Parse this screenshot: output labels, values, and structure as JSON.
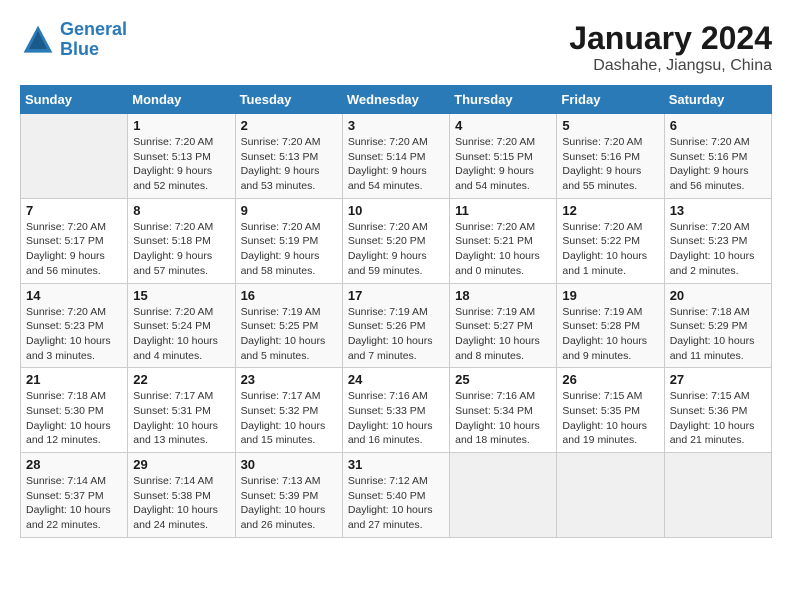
{
  "header": {
    "logo_line1": "General",
    "logo_line2": "Blue",
    "month": "January 2024",
    "location": "Dashahe, Jiangsu, China"
  },
  "weekdays": [
    "Sunday",
    "Monday",
    "Tuesday",
    "Wednesday",
    "Thursday",
    "Friday",
    "Saturday"
  ],
  "weeks": [
    [
      {
        "day": "",
        "info": ""
      },
      {
        "day": "1",
        "info": "Sunrise: 7:20 AM\nSunset: 5:13 PM\nDaylight: 9 hours\nand 52 minutes."
      },
      {
        "day": "2",
        "info": "Sunrise: 7:20 AM\nSunset: 5:13 PM\nDaylight: 9 hours\nand 53 minutes."
      },
      {
        "day": "3",
        "info": "Sunrise: 7:20 AM\nSunset: 5:14 PM\nDaylight: 9 hours\nand 54 minutes."
      },
      {
        "day": "4",
        "info": "Sunrise: 7:20 AM\nSunset: 5:15 PM\nDaylight: 9 hours\nand 54 minutes."
      },
      {
        "day": "5",
        "info": "Sunrise: 7:20 AM\nSunset: 5:16 PM\nDaylight: 9 hours\nand 55 minutes."
      },
      {
        "day": "6",
        "info": "Sunrise: 7:20 AM\nSunset: 5:16 PM\nDaylight: 9 hours\nand 56 minutes."
      }
    ],
    [
      {
        "day": "7",
        "info": "Sunrise: 7:20 AM\nSunset: 5:17 PM\nDaylight: 9 hours\nand 56 minutes."
      },
      {
        "day": "8",
        "info": "Sunrise: 7:20 AM\nSunset: 5:18 PM\nDaylight: 9 hours\nand 57 minutes."
      },
      {
        "day": "9",
        "info": "Sunrise: 7:20 AM\nSunset: 5:19 PM\nDaylight: 9 hours\nand 58 minutes."
      },
      {
        "day": "10",
        "info": "Sunrise: 7:20 AM\nSunset: 5:20 PM\nDaylight: 9 hours\nand 59 minutes."
      },
      {
        "day": "11",
        "info": "Sunrise: 7:20 AM\nSunset: 5:21 PM\nDaylight: 10 hours\nand 0 minutes."
      },
      {
        "day": "12",
        "info": "Sunrise: 7:20 AM\nSunset: 5:22 PM\nDaylight: 10 hours\nand 1 minute."
      },
      {
        "day": "13",
        "info": "Sunrise: 7:20 AM\nSunset: 5:23 PM\nDaylight: 10 hours\nand 2 minutes."
      }
    ],
    [
      {
        "day": "14",
        "info": "Sunrise: 7:20 AM\nSunset: 5:23 PM\nDaylight: 10 hours\nand 3 minutes."
      },
      {
        "day": "15",
        "info": "Sunrise: 7:20 AM\nSunset: 5:24 PM\nDaylight: 10 hours\nand 4 minutes."
      },
      {
        "day": "16",
        "info": "Sunrise: 7:19 AM\nSunset: 5:25 PM\nDaylight: 10 hours\nand 5 minutes."
      },
      {
        "day": "17",
        "info": "Sunrise: 7:19 AM\nSunset: 5:26 PM\nDaylight: 10 hours\nand 7 minutes."
      },
      {
        "day": "18",
        "info": "Sunrise: 7:19 AM\nSunset: 5:27 PM\nDaylight: 10 hours\nand 8 minutes."
      },
      {
        "day": "19",
        "info": "Sunrise: 7:19 AM\nSunset: 5:28 PM\nDaylight: 10 hours\nand 9 minutes."
      },
      {
        "day": "20",
        "info": "Sunrise: 7:18 AM\nSunset: 5:29 PM\nDaylight: 10 hours\nand 11 minutes."
      }
    ],
    [
      {
        "day": "21",
        "info": "Sunrise: 7:18 AM\nSunset: 5:30 PM\nDaylight: 10 hours\nand 12 minutes."
      },
      {
        "day": "22",
        "info": "Sunrise: 7:17 AM\nSunset: 5:31 PM\nDaylight: 10 hours\nand 13 minutes."
      },
      {
        "day": "23",
        "info": "Sunrise: 7:17 AM\nSunset: 5:32 PM\nDaylight: 10 hours\nand 15 minutes."
      },
      {
        "day": "24",
        "info": "Sunrise: 7:16 AM\nSunset: 5:33 PM\nDaylight: 10 hours\nand 16 minutes."
      },
      {
        "day": "25",
        "info": "Sunrise: 7:16 AM\nSunset: 5:34 PM\nDaylight: 10 hours\nand 18 minutes."
      },
      {
        "day": "26",
        "info": "Sunrise: 7:15 AM\nSunset: 5:35 PM\nDaylight: 10 hours\nand 19 minutes."
      },
      {
        "day": "27",
        "info": "Sunrise: 7:15 AM\nSunset: 5:36 PM\nDaylight: 10 hours\nand 21 minutes."
      }
    ],
    [
      {
        "day": "28",
        "info": "Sunrise: 7:14 AM\nSunset: 5:37 PM\nDaylight: 10 hours\nand 22 minutes."
      },
      {
        "day": "29",
        "info": "Sunrise: 7:14 AM\nSunset: 5:38 PM\nDaylight: 10 hours\nand 24 minutes."
      },
      {
        "day": "30",
        "info": "Sunrise: 7:13 AM\nSunset: 5:39 PM\nDaylight: 10 hours\nand 26 minutes."
      },
      {
        "day": "31",
        "info": "Sunrise: 7:12 AM\nSunset: 5:40 PM\nDaylight: 10 hours\nand 27 minutes."
      },
      {
        "day": "",
        "info": ""
      },
      {
        "day": "",
        "info": ""
      },
      {
        "day": "",
        "info": ""
      }
    ]
  ]
}
